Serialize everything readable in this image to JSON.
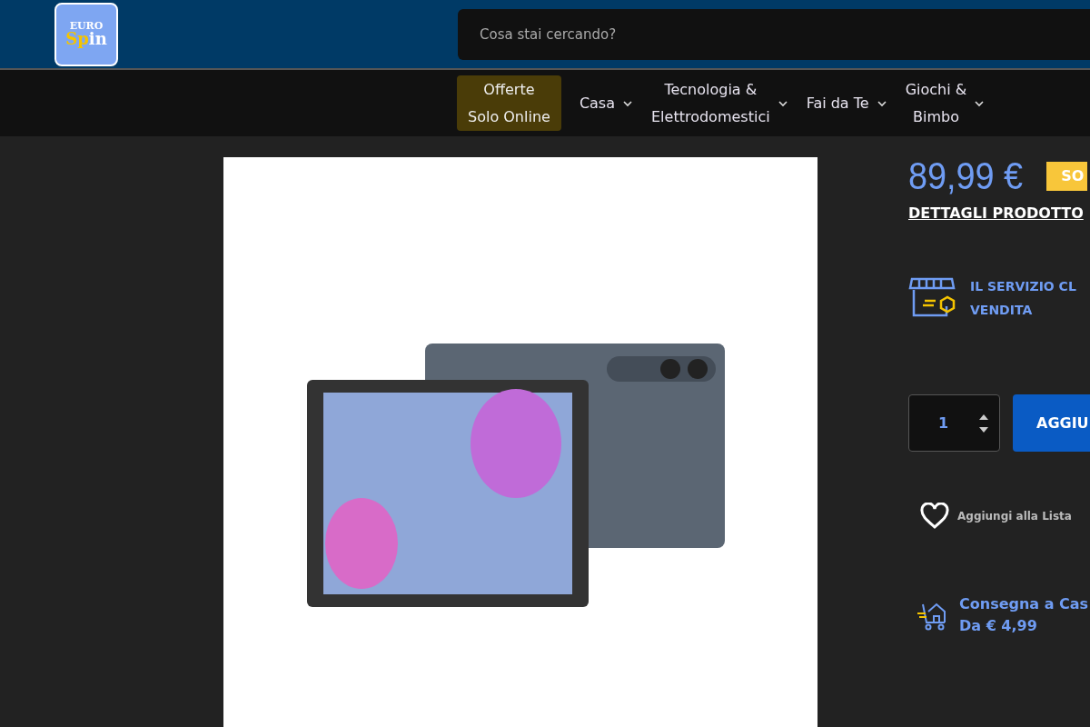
{
  "logo": {
    "line_1": "EURO",
    "line_2_highlight": "Sp",
    "line_2_rest": "in"
  },
  "search": {
    "placeholder": "Cosa stai cercando?"
  },
  "nav": [
    {
      "label_lines": [
        "Offerte",
        "Solo Online"
      ],
      "highlighted": true,
      "has_caret": false
    },
    {
      "label_lines": [
        "Casa"
      ],
      "highlighted": false,
      "has_caret": true
    },
    {
      "label_lines": [
        "Tecnologia &",
        "Elettrodomestici"
      ],
      "highlighted": false,
      "has_caret": true
    },
    {
      "label_lines": [
        "Fai da Te"
      ],
      "highlighted": false,
      "has_caret": true
    },
    {
      "label_lines": [
        "Giochi &",
        "Bimbo"
      ],
      "highlighted": false,
      "has_caret": true
    }
  ],
  "product": {
    "price": "89,99 €",
    "badge": "SO",
    "details_link": "DETTAGLI PRODOTTO",
    "service_text": "IL SERVIZIO CL VENDITA",
    "quantity": "1",
    "add_button": "AGGIU",
    "wishlist": "Aggiungi alla Lista",
    "delivery_title": "Consegna a Cas",
    "delivery_price": "Da € 4,99"
  }
}
